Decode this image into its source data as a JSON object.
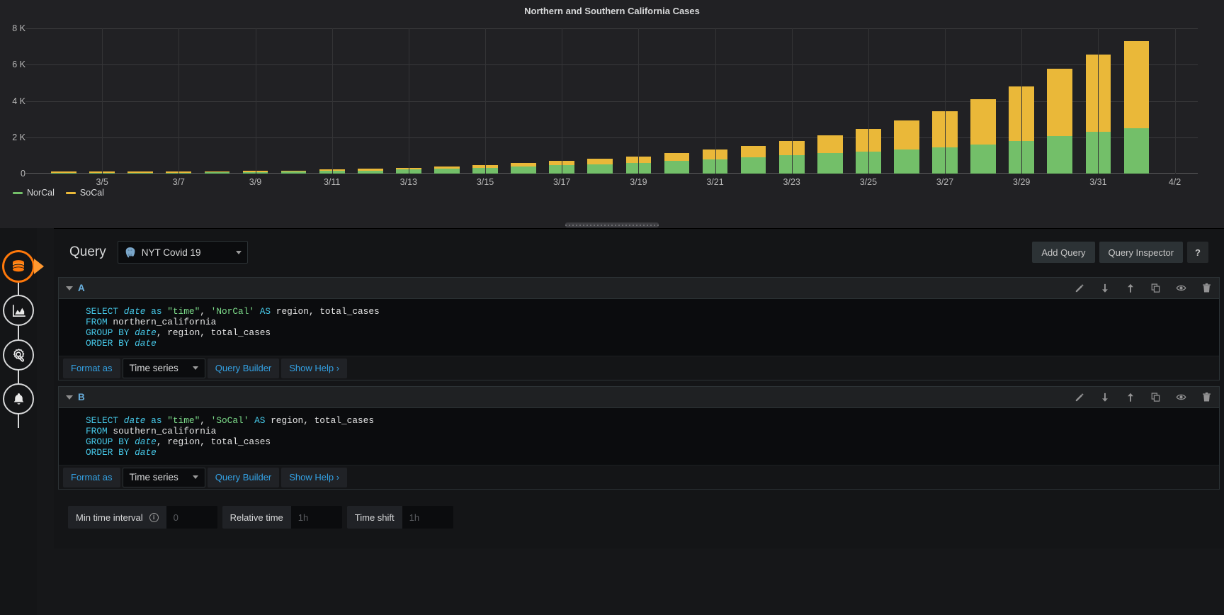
{
  "panel": {
    "title": "Northern and Southern California Cases",
    "resize_handle": "panel-resize-handle"
  },
  "chart_data": {
    "type": "bar",
    "stacked": true,
    "title": "Northern and Southern California Cases",
    "xlabel": "",
    "ylabel": "",
    "ylim": [
      0,
      8000
    ],
    "yticks": [
      "0",
      "2 K",
      "4 K",
      "6 K",
      "8 K"
    ],
    "ytick_values": [
      0,
      2000,
      4000,
      6000,
      8000
    ],
    "grid": true,
    "legend_position": "bottom-left",
    "xtick_labels": [
      "3/5",
      "3/7",
      "3/9",
      "3/11",
      "3/13",
      "3/15",
      "3/17",
      "3/19",
      "3/21",
      "3/23",
      "3/25",
      "3/27",
      "3/29",
      "3/31",
      "4/2"
    ],
    "categories": [
      "3/4",
      "3/5",
      "3/6",
      "3/7",
      "3/8",
      "3/9",
      "3/10",
      "3/11",
      "3/12",
      "3/13",
      "3/14",
      "3/15",
      "3/16",
      "3/17",
      "3/18",
      "3/19",
      "3/20",
      "3/21",
      "3/22",
      "3/23",
      "3/24",
      "3/25",
      "3/26",
      "3/27",
      "3/28",
      "3/29",
      "3/30",
      "3/31",
      "4/1"
    ],
    "series": [
      {
        "name": "NorCal",
        "color": "#73bf69",
        "values": [
          20,
          35,
          45,
          55,
          70,
          95,
          110,
          140,
          175,
          220,
          265,
          320,
          390,
          450,
          520,
          600,
          690,
          790,
          900,
          1010,
          1120,
          1220,
          1320,
          1450,
          1620,
          1800,
          2080,
          2290,
          2480
        ]
      },
      {
        "name": "SoCal",
        "color": "#eab839",
        "values": [
          15,
          20,
          25,
          30,
          40,
          50,
          60,
          80,
          90,
          110,
          130,
          160,
          200,
          240,
          290,
          350,
          430,
          520,
          640,
          790,
          980,
          1250,
          1600,
          1980,
          2460,
          3000,
          3680,
          4260,
          4820
        ]
      }
    ]
  },
  "nav": {
    "items": [
      {
        "name": "queries",
        "icon": "database-icon",
        "active": true
      },
      {
        "name": "visualization",
        "icon": "chart-area-icon",
        "active": false
      },
      {
        "name": "general-settings",
        "icon": "gear-wrench-icon",
        "active": false
      },
      {
        "name": "alerts",
        "icon": "bell-icon",
        "active": false
      }
    ]
  },
  "editor": {
    "heading": "Query",
    "datasource": {
      "name": "NYT Covid 19",
      "icon": "postgres-elephant-icon"
    },
    "header_actions": [
      {
        "label": "Add Query",
        "name": "add-query-button"
      },
      {
        "label": "Query Inspector",
        "name": "query-inspector-button"
      },
      {
        "label": "?",
        "name": "help-button"
      }
    ],
    "row_icons": [
      "pencil-icon",
      "arrow-down-icon",
      "arrow-up-icon",
      "duplicate-icon",
      "eye-icon",
      "trash-icon"
    ],
    "queries": [
      {
        "letter": "A",
        "sql_lines": [
          [
            {
              "t": "SELECT ",
              "c": "kw"
            },
            {
              "t": "date",
              "c": "kwi"
            },
            {
              "t": " as ",
              "c": "kw"
            },
            {
              "t": "\"time\"",
              "c": "str"
            },
            {
              "t": ", ",
              "c": "plain"
            },
            {
              "t": "'NorCal'",
              "c": "str"
            },
            {
              "t": " AS",
              "c": "kw"
            },
            {
              "t": " region, total_cases",
              "c": "plain"
            }
          ],
          [
            {
              "t": "FROM",
              "c": "kw"
            },
            {
              "t": " northern_california",
              "c": "plain"
            }
          ],
          [
            {
              "t": "GROUP BY ",
              "c": "kw"
            },
            {
              "t": "date",
              "c": "kwi"
            },
            {
              "t": ", region, total_cases",
              "c": "plain"
            }
          ],
          [
            {
              "t": "ORDER BY ",
              "c": "kw"
            },
            {
              "t": "date",
              "c": "kwi"
            }
          ]
        ],
        "format_label": "Format as",
        "format_value": "Time series",
        "query_builder_label": "Query Builder",
        "show_help_label": "Show Help ›"
      },
      {
        "letter": "B",
        "sql_lines": [
          [
            {
              "t": "SELECT ",
              "c": "kw"
            },
            {
              "t": "date",
              "c": "kwi"
            },
            {
              "t": " as ",
              "c": "kw"
            },
            {
              "t": "\"time\"",
              "c": "str"
            },
            {
              "t": ", ",
              "c": "plain"
            },
            {
              "t": "'SoCal'",
              "c": "str"
            },
            {
              "t": " AS",
              "c": "kw"
            },
            {
              "t": " region, total_cases",
              "c": "plain"
            }
          ],
          [
            {
              "t": "FROM",
              "c": "kw"
            },
            {
              "t": " southern_california",
              "c": "plain"
            }
          ],
          [
            {
              "t": "GROUP BY ",
              "c": "kw"
            },
            {
              "t": "date",
              "c": "kwi"
            },
            {
              "t": ", region, total_cases",
              "c": "plain"
            }
          ],
          [
            {
              "t": "ORDER BY ",
              "c": "kw"
            },
            {
              "t": "date",
              "c": "kwi"
            }
          ]
        ],
        "format_label": "Format as",
        "format_value": "Time series",
        "query_builder_label": "Query Builder",
        "show_help_label": "Show Help ›"
      }
    ],
    "options": {
      "min_time_interval": {
        "label": "Min time interval",
        "value": "",
        "placeholder": "0"
      },
      "relative_time": {
        "label": "Relative time",
        "value": "",
        "placeholder": "1h"
      },
      "time_shift": {
        "label": "Time shift",
        "value": "",
        "placeholder": "1h"
      }
    }
  },
  "colors": {
    "nor_cal": "#73bf69",
    "so_cal": "#eab839",
    "accent_blue": "#33a2e5",
    "accent_orange": "#ff780a",
    "panel_bg": "#212124",
    "editor_bg": "#141517"
  }
}
